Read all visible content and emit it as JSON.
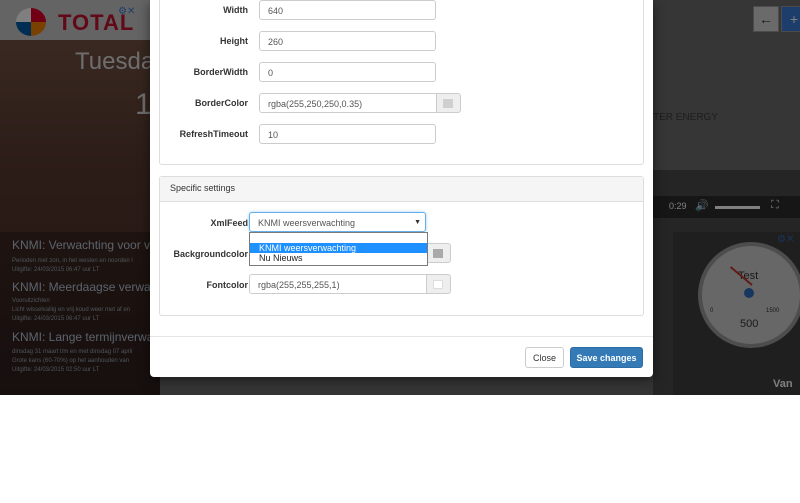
{
  "background": {
    "brand": "TOTAL",
    "date_text": "Tuesda",
    "date_num": "1",
    "energy_text": "TER ENERGY",
    "news": [
      {
        "title": "KNMI: Verwachting voor va",
        "lines": [
          "Perioden met zon, in het westen en noorden l",
          "Uitgifte: 24/03/2015 06:47 uur LT"
        ]
      },
      {
        "title": "KNMI: Meerdaagse verwac",
        "lines": [
          "Vooruitzichten",
          "Licht wisselvallig en vrij koud weer met af en",
          "Uitgifte: 24/03/2015 06:47 uur LT"
        ]
      },
      {
        "title": "KNMI: Lange termijnverwa",
        "lines": [
          "dinsdag 31 maart t/m en met dinsdag 07 april",
          "Grote kans (60-70%) op het aanhouden van",
          "Uitgifte: 24/03/2015 02:50 uur LT"
        ]
      }
    ],
    "video_time": "0:29",
    "gauge": {
      "title": "Test",
      "value": "500",
      "min": "0",
      "max": "1500"
    },
    "corner_text": "Van"
  },
  "modal": {
    "fields": [
      {
        "label": "Width",
        "value": "640"
      },
      {
        "label": "Height",
        "value": "260"
      },
      {
        "label": "BorderWidth",
        "value": "0"
      },
      {
        "label": "BorderColor",
        "value": "rgba(255,250,250,0.35)",
        "swatch": "#cfcfcf"
      },
      {
        "label": "RefreshTimeout",
        "value": "10"
      }
    ],
    "specific": {
      "heading": "Specific settings",
      "xmlfeed_label": "XmlFeed",
      "xmlfeed_value": "KNMI weersverwachting",
      "xmlfeed_options": [
        "KNMI weersverwachting",
        "Nu Nieuws"
      ],
      "bgcolor_label": "Backgroundcolor",
      "bgcolor_swatch": "#aaaaaa",
      "fontcolor_label": "Fontcolor",
      "fontcolor_value": "rgba(255,255,255,1)",
      "fontcolor_swatch": "#ffffff"
    },
    "close_label": "Close",
    "save_label": "Save changes"
  },
  "colors": {
    "primary": "#337ab7",
    "focus": "#66afe9",
    "highlight": "#1e90ff"
  }
}
